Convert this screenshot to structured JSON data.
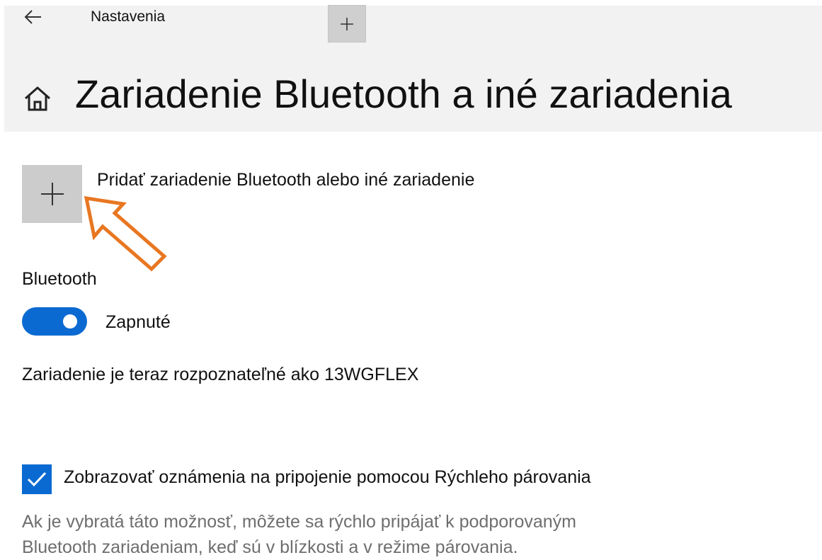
{
  "window": {
    "title": "Nastavenia",
    "back_icon": "back-arrow-icon",
    "new_tab_icon": "plus-icon"
  },
  "page": {
    "title": "Zariadenie Bluetooth a iné zariadenia",
    "home_icon": "home-icon"
  },
  "add_device": {
    "label": "Pridať zariadenie Bluetooth alebo iné zariadenie",
    "icon": "plus-icon",
    "annotation_color": "#E87722"
  },
  "bluetooth": {
    "heading": "Bluetooth",
    "toggle_on": true,
    "toggle_state": "Zapnuté",
    "toggle_color": "#0A6AD1",
    "discoverable_text": "Zariadenie je teraz rozpoznateľné ako 13WGFLEX"
  },
  "swift_pair": {
    "checked": true,
    "label": "Zobrazovať oznámenia na pripojenie pomocou Rýchleho párovania",
    "help_line1": "Ak je vybratá táto možnosť, môžete sa rýchlo pripájať k podporovaným",
    "help_line2": "Bluetooth zariadeniam, keď sú v blízkosti a v režime párovania."
  }
}
